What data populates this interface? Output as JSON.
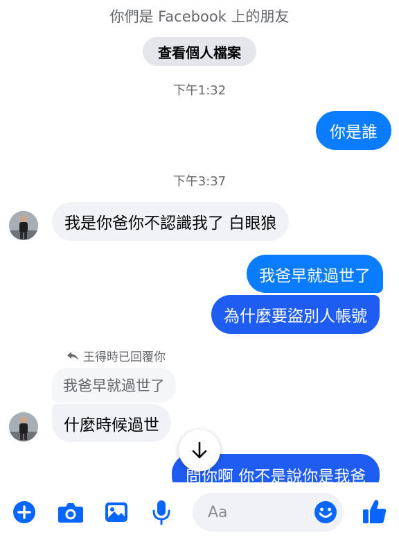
{
  "header": {
    "friends_note": "你們是 Facebook 上的朋友",
    "view_profile_label": "查看個人檔案"
  },
  "messages": {
    "time1": "下午1:32",
    "out1": "你是誰",
    "time2": "下午3:37",
    "in1": "我是你爸你不認識我了 白眼狼",
    "out2": "我爸早就過世了",
    "out3": "為什麼要盜別人帳號",
    "reply_label": "王得時已回覆你",
    "quoted": "我爸早就過世了",
    "in2": "什麼時候過世",
    "out4_partial": "問你啊 你不是說你是我爸"
  },
  "composer": {
    "placeholder": "Aa"
  },
  "colors": {
    "messenger_blue": "#0a7cff",
    "incoming_bg": "#f0f2f5",
    "accent": "#0866ff"
  },
  "icons": [
    "plus-icon",
    "camera-icon",
    "image-icon",
    "microphone-icon",
    "emoji-icon",
    "thumbs-up-icon",
    "arrow-down-icon",
    "reply-arrow-icon"
  ]
}
